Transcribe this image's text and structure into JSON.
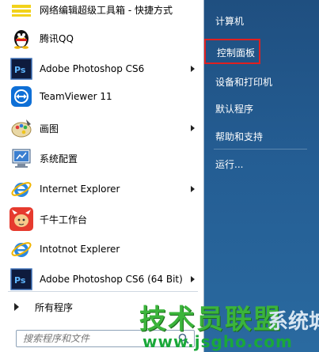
{
  "programs": [
    {
      "label": "网络编辑超级工具箱 - 快捷方式",
      "icon": "toolbox-icon",
      "arrow": false
    },
    {
      "label": "腾讯QQ",
      "icon": "qq-penguin-icon",
      "arrow": false
    },
    {
      "label": "Adobe Photoshop CS6",
      "icon": "photoshop-icon",
      "arrow": true
    },
    {
      "label": "TeamViewer 11",
      "icon": "teamviewer-icon",
      "arrow": false
    },
    {
      "label": "画图",
      "icon": "paint-palette-icon",
      "arrow": true
    },
    {
      "label": "系统配置",
      "icon": "system-config-icon",
      "arrow": false
    },
    {
      "label": "Internet Explorer",
      "icon": "internet-explorer-icon",
      "arrow": true
    },
    {
      "label": "千牛工作台",
      "icon": "qianniu-icon",
      "arrow": false
    },
    {
      "label": "Intotnot  Explerer",
      "icon": "internet-explorer-icon",
      "arrow": false
    },
    {
      "label": "Adobe Photoshop CS6 (64 Bit)",
      "icon": "photoshop-icon",
      "arrow": true
    }
  ],
  "all_programs": "所有程序",
  "search": {
    "placeholder": "搜索程序和文件"
  },
  "right_menu": {
    "computer": "计算机",
    "control_panel": "控制面板",
    "devices_printers": "设备和打印机",
    "default_programs": "默认程序",
    "help_support": "帮助和支持",
    "run": "运行..."
  },
  "watermark": {
    "main": "技术员联盟",
    "side": "系统城",
    "url": "www.jsgho.com"
  },
  "colors": {
    "highlight_box": "#e02020",
    "right_panel": "#245d93",
    "watermark_green": "#3bb43b"
  }
}
